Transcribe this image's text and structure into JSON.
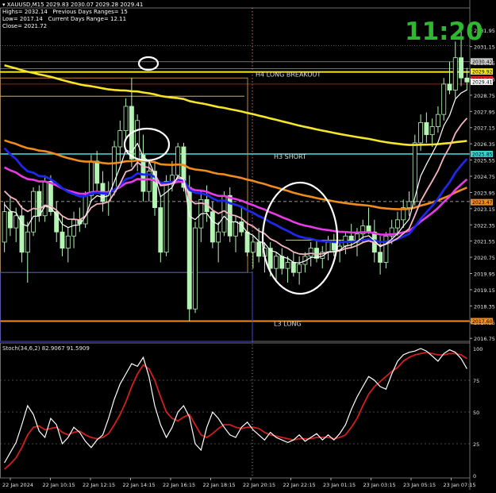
{
  "header": {
    "symbol": "XAUUSD,M15",
    "ohlc": "2029.83 2030.07 2029.28 2029.41",
    "highs": "Highs= 2032.14",
    "prev_ranges": "Previous Days Ranges= 15",
    "lows": "Low= 2017.14",
    "curr_ranges": "Current Days Range= 12.11",
    "close": "Close= 2021.72"
  },
  "clock": "11:20",
  "colors": {
    "candle": "#b4f5b4",
    "ema_yellow": "#f5e52a",
    "ema_orange": "#f08c1e",
    "ema_magenta": "#e63ce6",
    "ema_blue": "#1e28e6",
    "ema_pink": "#f5b4c3",
    "ema_white": "#ffffff",
    "level_cyan": "#3cd2d2",
    "level_orange": "#f08c1e",
    "stoch_main": "#ffffff",
    "stoch_signal": "#d21e1e"
  },
  "chart_data": [
    {
      "type": "candlestick",
      "title": "XAUUSD,M15",
      "ylim": [
        2016.6,
        2032.9
      ],
      "y_ticks": [
        "2031.95",
        "2031.15",
        "2030.35",
        "2029.55",
        "2028.75",
        "2027.95",
        "2027.15",
        "2026.35",
        "2025.55",
        "2024.75",
        "2023.95",
        "2023.15",
        "2022.35",
        "2021.55",
        "2020.75",
        "2019.95",
        "2019.15",
        "2018.35",
        "2017.55",
        "2016.75"
      ],
      "price_tags": [
        {
          "value": "2030.42",
          "color": "#c8c8c8"
        },
        {
          "value": "2029.92",
          "color": "#f5e52a"
        },
        {
          "value": "2029.54",
          "color": "#dc1e1e"
        },
        {
          "value": "2029.41",
          "color": "#ffffff"
        },
        {
          "value": "2025.85",
          "color": "#3cd2d2"
        },
        {
          "value": "2023.47",
          "color": "#f08c1e"
        },
        {
          "value": "2017.60",
          "color": "#f08c1e"
        }
      ],
      "levels": [
        {
          "name": "H4 LONG BREAKOUT",
          "price": 2029.9
        },
        {
          "name": "H3 SHORT",
          "price": 2025.85
        },
        {
          "name": "L3 LONG",
          "price": 2017.6
        }
      ],
      "candles": [
        [
          2021.5,
          2023.5,
          2021.0,
          2023.0
        ],
        [
          2023.0,
          2023.8,
          2021.8,
          2022.2
        ],
        [
          2022.2,
          2023.2,
          2021.5,
          2022.8
        ],
        [
          2022.8,
          2023.3,
          2020.5,
          2021.0
        ],
        [
          2021.0,
          2022.5,
          2019.5,
          2022.0
        ],
        [
          2022.0,
          2024.2,
          2021.8,
          2024.0
        ],
        [
          2024.0,
          2024.3,
          2022.5,
          2022.8
        ],
        [
          2022.8,
          2024.8,
          2022.5,
          2024.5
        ],
        [
          2024.5,
          2024.8,
          2022.8,
          2023.0
        ],
        [
          2023.0,
          2023.5,
          2021.5,
          2022.0
        ],
        [
          2022.0,
          2022.8,
          2020.8,
          2021.2
        ],
        [
          2021.2,
          2022.2,
          2020.5,
          2021.8
        ],
        [
          2021.8,
          2023.0,
          2021.2,
          2022.6
        ],
        [
          2022.6,
          2023.2,
          2022.0,
          2022.4
        ],
        [
          2022.4,
          2024.0,
          2022.2,
          2023.8
        ],
        [
          2023.8,
          2025.8,
          2023.5,
          2025.5
        ],
        [
          2025.5,
          2026.0,
          2024.0,
          2024.4
        ],
        [
          2024.4,
          2025.0,
          2023.0,
          2023.5
        ],
        [
          2023.5,
          2024.5,
          2022.8,
          2024.0
        ],
        [
          2024.0,
          2026.5,
          2023.8,
          2026.2
        ],
        [
          2026.2,
          2027.5,
          2025.5,
          2027.0
        ],
        [
          2027.0,
          2028.6,
          2026.5,
          2028.2
        ],
        [
          2028.2,
          2029.6,
          2025.2,
          2025.6
        ],
        [
          2025.6,
          2027.8,
          2025.0,
          2027.5
        ],
        [
          2025.8,
          2026.8,
          2023.5,
          2024.0
        ],
        [
          2024.0,
          2025.5,
          2023.5,
          2025.0
        ],
        [
          2025.0,
          2025.5,
          2022.8,
          2023.2
        ],
        [
          2023.2,
          2023.8,
          2020.5,
          2021.0
        ],
        [
          2021.0,
          2024.8,
          2020.8,
          2024.5
        ],
        [
          2024.5,
          2025.5,
          2024.0,
          2024.8
        ],
        [
          2024.8,
          2026.4,
          2024.5,
          2026.2
        ],
        [
          2026.2,
          2026.4,
          2024.0,
          2024.2
        ],
        [
          2024.2,
          2024.8,
          2017.6,
          2018.2
        ],
        [
          2018.2,
          2022.5,
          2018.0,
          2022.2
        ],
        [
          2022.2,
          2024.0,
          2021.5,
          2023.6
        ],
        [
          2023.6,
          2024.3,
          2022.5,
          2023.0
        ],
        [
          2023.0,
          2023.5,
          2021.2,
          2021.5
        ],
        [
          2021.5,
          2022.5,
          2020.5,
          2022.0
        ],
        [
          2022.0,
          2024.0,
          2021.8,
          2023.8
        ],
        [
          2023.8,
          2024.2,
          2021.5,
          2021.8
        ],
        [
          2021.8,
          2022.8,
          2021.0,
          2022.5
        ],
        [
          2022.5,
          2023.2,
          2021.8,
          2022.0
        ],
        [
          2022.0,
          2022.5,
          2020.8,
          2021.0
        ],
        [
          2021.0,
          2021.8,
          2020.2,
          2021.5
        ],
        [
          2021.5,
          2022.2,
          2020.5,
          2020.8
        ],
        [
          2020.8,
          2021.5,
          2020.0,
          2021.2
        ],
        [
          2021.2,
          2021.5,
          2019.8,
          2020.2
        ],
        [
          2020.2,
          2021.0,
          2019.6,
          2020.8
        ],
        [
          2020.8,
          2021.2,
          2019.9,
          2020.2
        ],
        [
          2020.2,
          2020.8,
          2019.5,
          2020.5
        ],
        [
          2020.5,
          2021.0,
          2019.8,
          2020.0
        ],
        [
          2020.0,
          2020.8,
          2019.4,
          2020.4
        ],
        [
          2020.4,
          2021.0,
          2020.0,
          2020.8
        ],
        [
          2020.8,
          2021.5,
          2020.3,
          2021.2
        ],
        [
          2021.2,
          2021.6,
          2020.5,
          2020.7
        ],
        [
          2020.7,
          2021.3,
          2020.2,
          2021.0
        ],
        [
          2021.0,
          2021.8,
          2020.6,
          2021.5
        ],
        [
          2021.5,
          2021.9,
          2020.8,
          2021.1
        ],
        [
          2021.1,
          2021.6,
          2020.5,
          2021.3
        ],
        [
          2021.3,
          2022.0,
          2020.9,
          2021.8
        ],
        [
          2021.8,
          2022.4,
          2021.2,
          2021.5
        ],
        [
          2021.5,
          2022.2,
          2020.8,
          2021.9
        ],
        [
          2021.9,
          2022.6,
          2021.5,
          2022.3
        ],
        [
          2022.3,
          2023.2,
          2021.9,
          2022.0
        ],
        [
          2022.0,
          2022.6,
          2020.5,
          2021.0
        ],
        [
          2021.0,
          2021.8,
          2019.9,
          2020.5
        ],
        [
          2020.5,
          2022.0,
          2020.2,
          2021.8
        ],
        [
          2021.8,
          2022.6,
          2021.4,
          2022.2
        ],
        [
          2022.2,
          2023.0,
          2021.8,
          2022.6
        ],
        [
          2022.6,
          2023.6,
          2022.2,
          2023.2
        ],
        [
          2023.2,
          2024.0,
          2022.8,
          2023.5
        ],
        [
          2023.5,
          2026.8,
          2023.3,
          2026.4
        ],
        [
          2026.4,
          2027.8,
          2026.0,
          2027.4
        ],
        [
          2027.4,
          2027.9,
          2026.4,
          2026.8
        ],
        [
          2026.8,
          2027.6,
          2026.2,
          2027.2
        ],
        [
          2027.2,
          2028.2,
          2026.9,
          2027.8
        ],
        [
          2027.8,
          2029.6,
          2027.5,
          2029.3
        ],
        [
          2029.3,
          2030.4,
          2028.8,
          2029.0
        ],
        [
          2029.0,
          2031.4,
          2028.6,
          2030.6
        ],
        [
          2030.6,
          2031.9,
          2029.2,
          2029.6
        ],
        [
          2029.6,
          2030.1,
          2029.0,
          2029.4
        ]
      ],
      "x_ticks": [
        "22 Jan 2024",
        "22 Jan 10:15",
        "22 Jan 12:15",
        "22 Jan 14:15",
        "22 Jan 16:15",
        "22 Jan 18:15",
        "22 Jan 20:15",
        "22 Jan 22:15",
        "23 Jan 01:15",
        "23 Jan 03:15",
        "23 Jan 05:15",
        "23 Jan 07:15"
      ]
    },
    {
      "type": "line",
      "title": "Stoch(34,6,2) 82.9067 91.5909",
      "ylim": [
        0,
        100
      ],
      "y_ticks": [
        "100",
        "75",
        "50",
        "25",
        "0"
      ],
      "series": [
        {
          "values": [
            10,
            18,
            26,
            40,
            55,
            48,
            35,
            30,
            45,
            40,
            25,
            30,
            38,
            34,
            27,
            22,
            28,
            32,
            45,
            60,
            72,
            80,
            88,
            86,
            93,
            78,
            55,
            40,
            30,
            38,
            50,
            55,
            46,
            25,
            20,
            38,
            50,
            45,
            38,
            32,
            30,
            38,
            42,
            36,
            32,
            28,
            34,
            30,
            28,
            26,
            28,
            32,
            27,
            30,
            33,
            28,
            32,
            28,
            33,
            40,
            52,
            62,
            70,
            78,
            75,
            70,
            68,
            80,
            90,
            95,
            97,
            98,
            100,
            98,
            94,
            90,
            96,
            99,
            97,
            92,
            84
          ]
        },
        {
          "values": [
            5,
            9,
            14,
            22,
            32,
            38,
            39,
            36,
            37,
            38,
            34,
            32,
            34,
            35,
            32,
            30,
            29,
            30,
            33,
            40,
            48,
            58,
            70,
            80,
            87,
            84,
            75,
            62,
            50,
            45,
            43,
            46,
            48,
            40,
            32,
            30,
            33,
            37,
            40,
            40,
            38,
            37,
            38,
            38,
            37,
            34,
            32,
            31,
            30,
            29,
            28,
            29,
            29,
            29,
            30,
            30,
            30,
            29,
            30,
            32,
            38,
            45,
            55,
            64,
            70,
            74,
            78,
            82,
            85,
            90,
            93,
            95,
            96,
            97,
            96,
            95,
            95,
            96,
            96,
            95,
            92
          ]
        }
      ]
    }
  ]
}
